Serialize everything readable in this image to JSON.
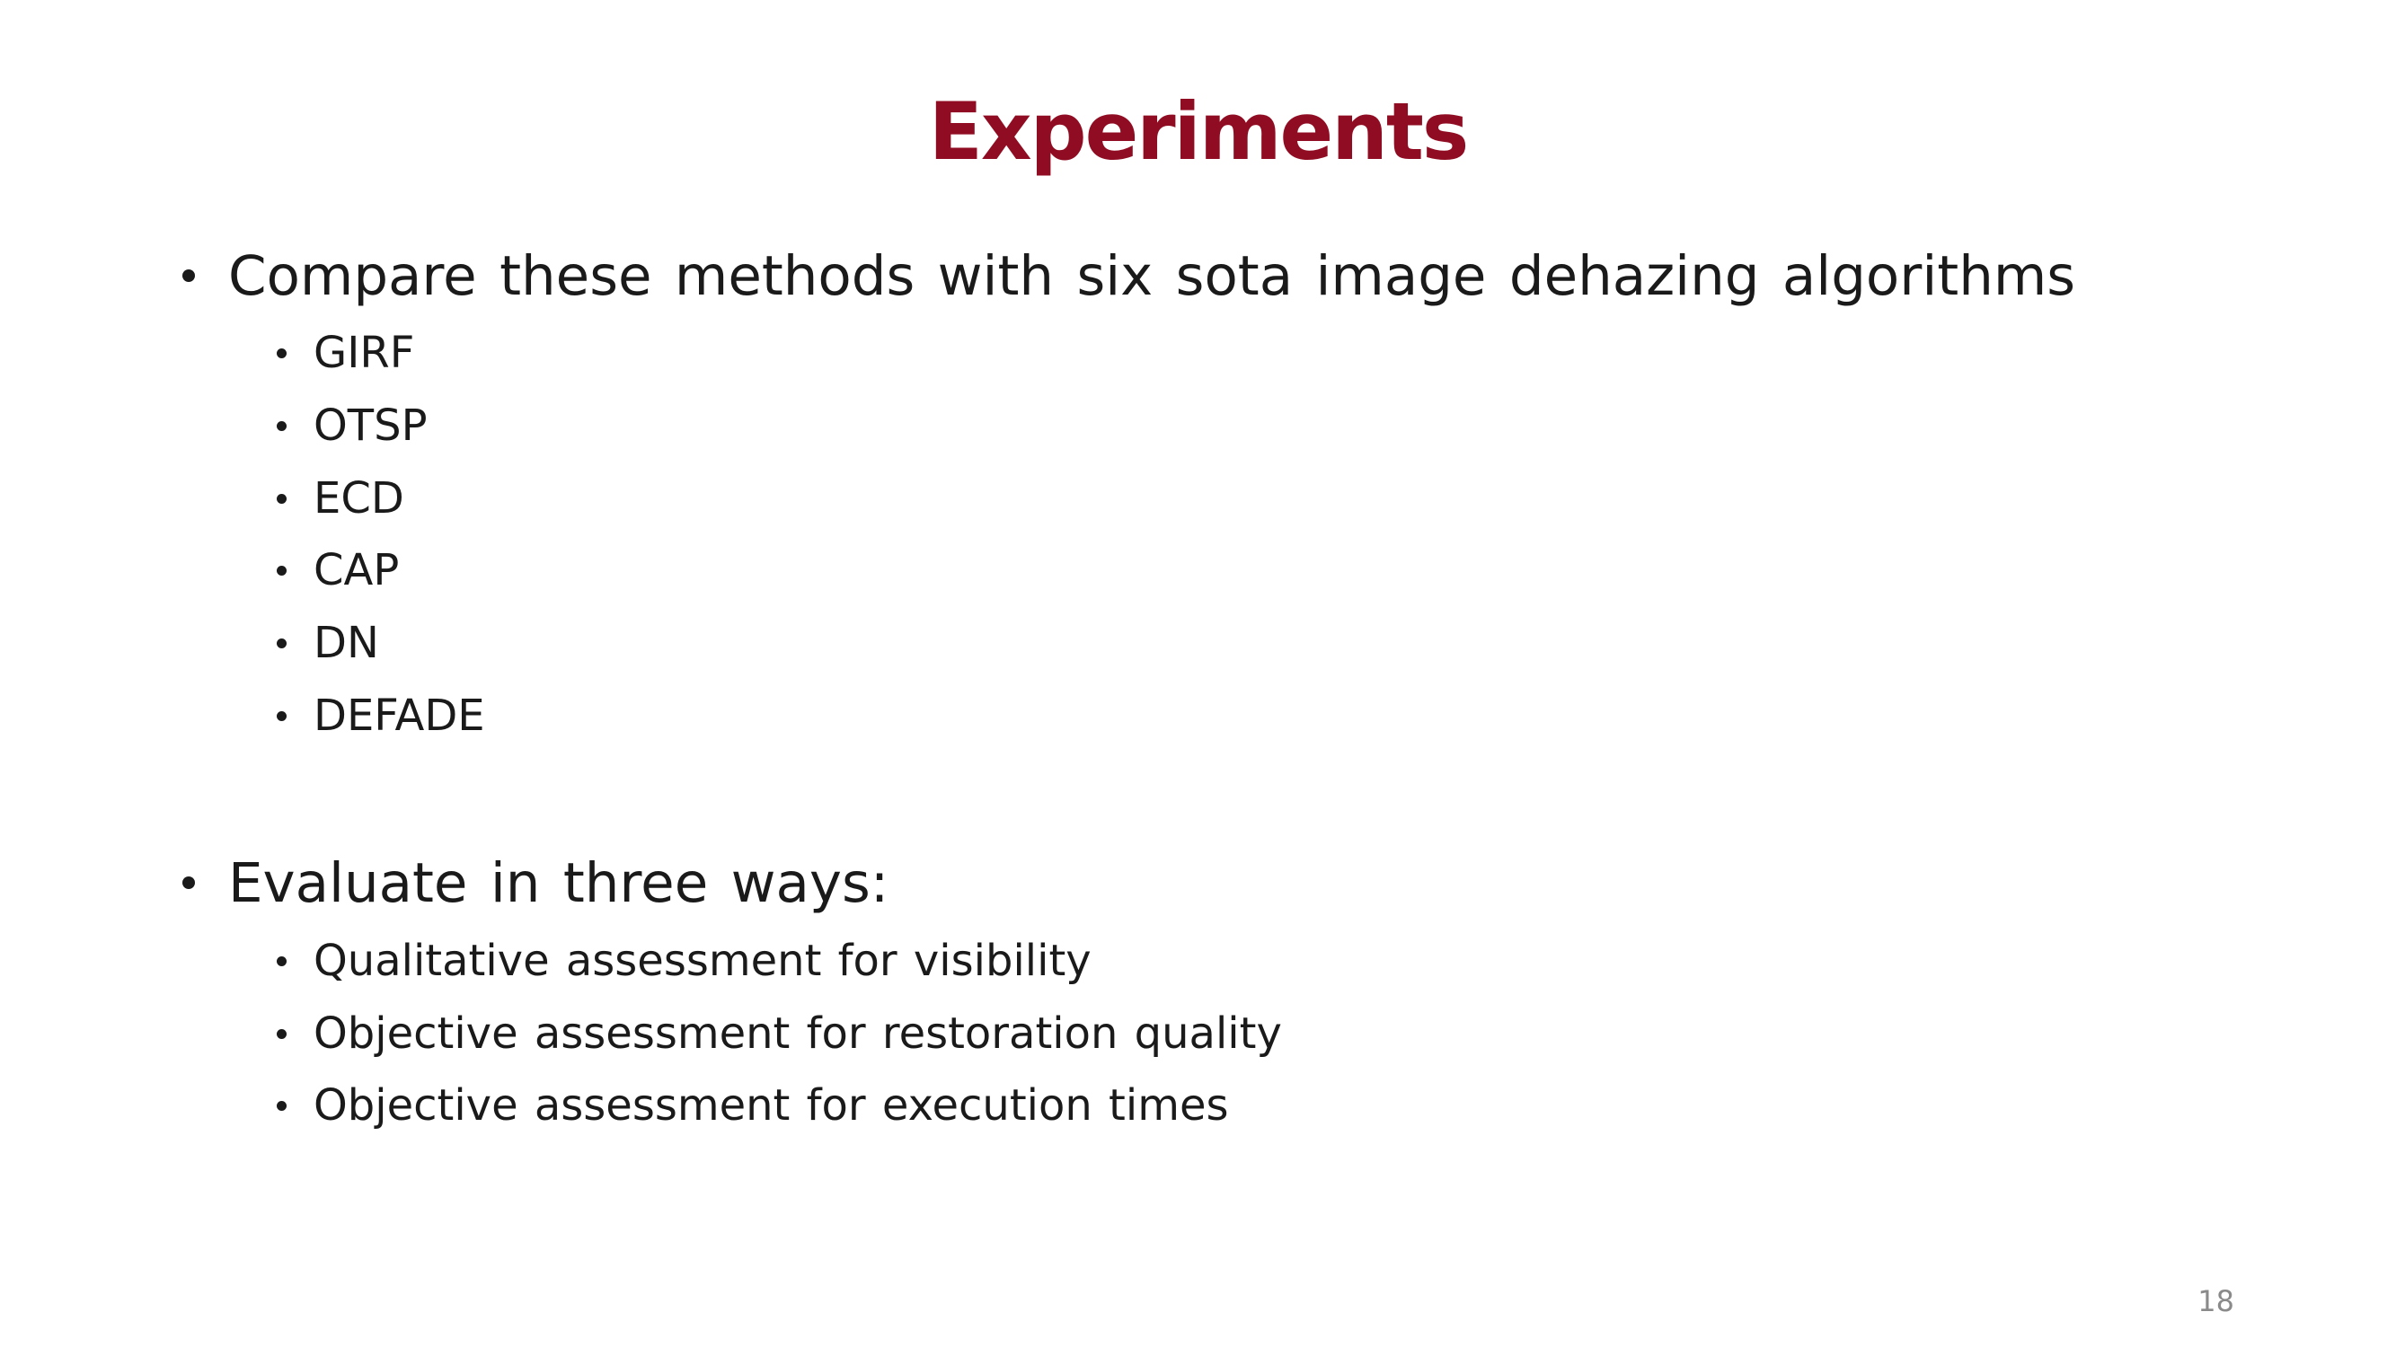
{
  "slide": {
    "title": "Experiments",
    "sections": [
      {
        "text": "Compare these methods with six sota image dehazing algorithms",
        "items": [
          "GIRF",
          "OTSP",
          "ECD",
          "CAP",
          "DN",
          "DEFADE"
        ]
      },
      {
        "text": "Evaluate in three ways:",
        "items": [
          "Qualitative assessment for visibility",
          "Objective assessment for restoration quality",
          "Objective assessment for execution times"
        ]
      }
    ],
    "page_number": "18",
    "colors": {
      "title": "#900c22",
      "text": "#1a1a1a",
      "page_number": "#8a8a8a"
    }
  }
}
